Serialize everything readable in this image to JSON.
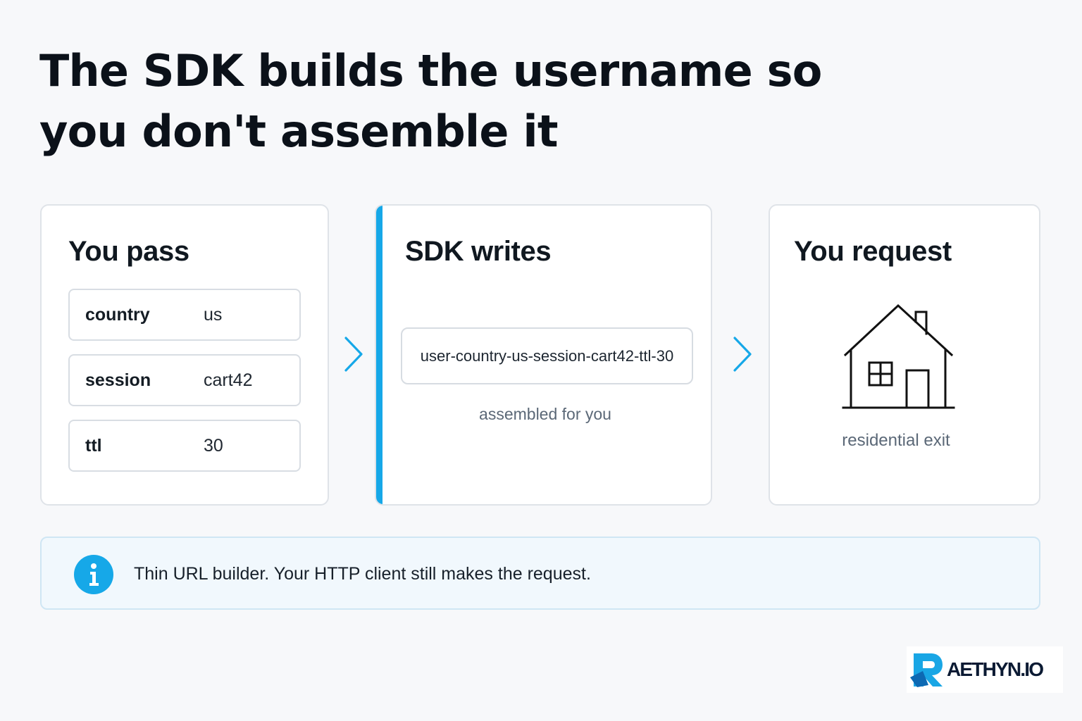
{
  "headline": "The SDK builds the username so you don't assemble it",
  "steps": {
    "pass": {
      "title": "You pass",
      "params": [
        {
          "key": "country",
          "value": "us"
        },
        {
          "key": "session",
          "value": "cart42"
        },
        {
          "key": "ttl",
          "value": "30"
        }
      ]
    },
    "sdk": {
      "title": "SDK writes",
      "username": "user-country-us-session-cart42-ttl-30",
      "caption": "assembled for you"
    },
    "request": {
      "title": "You request",
      "icon": "house-icon",
      "caption": "residential exit"
    }
  },
  "note": {
    "icon": "info-icon",
    "text": "Thin URL builder. Your HTTP client still makes the request."
  },
  "brand": {
    "name": "AETHYN.IO"
  },
  "colors": {
    "accent": "#16a8e8",
    "background": "#f7f8fa",
    "note_background": "#f1f8fd",
    "text": "#0f1720",
    "muted_text": "#5b6877"
  }
}
